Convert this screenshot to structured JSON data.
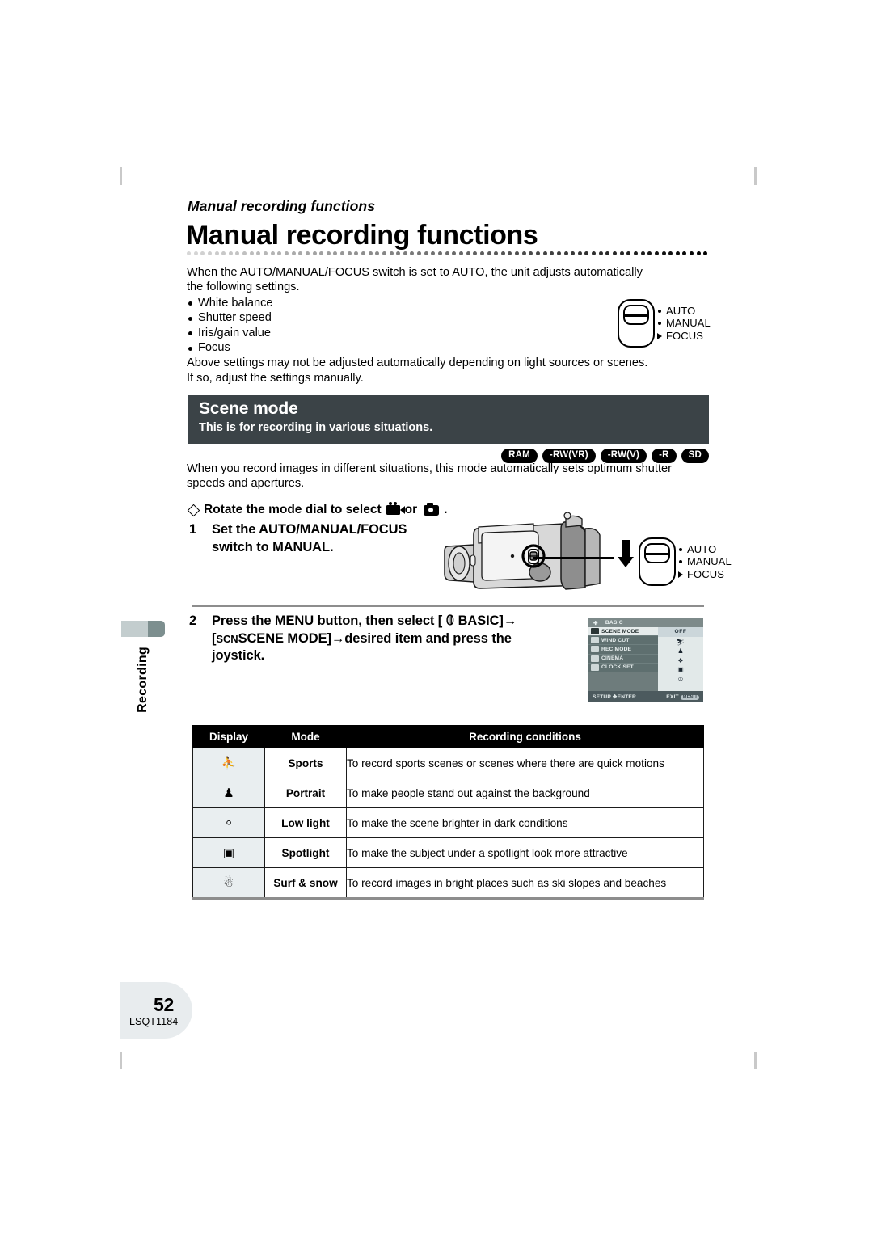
{
  "running_head": "Manual recording functions",
  "page_title": "Manual recording functions",
  "intro": {
    "paragraph1": "When the AUTO/MANUAL/FOCUS switch is set to AUTO, the unit adjusts automatically the following settings.",
    "bullets": [
      "White balance",
      "Shutter speed",
      "Iris/gain value",
      "Focus"
    ],
    "paragraph2": "Above settings may not be adjusted automatically depending on light sources or scenes. If so, adjust the settings manually."
  },
  "switch_labels": [
    "AUTO",
    "MANUAL",
    "FOCUS"
  ],
  "section": {
    "title": "Scene mode",
    "subtitle": "This is for recording in various situations.",
    "badges": [
      "RAM",
      "-RW(VR)",
      "-RW(V)",
      "-R",
      "SD"
    ],
    "body": "When you record images in different situations, this mode automatically sets optimum shutter speeds and apertures."
  },
  "steps": {
    "diamond": {
      "before": "Rotate the mode dial to select",
      "middle": "or",
      "after": "."
    },
    "step1": {
      "number": "1",
      "line1": "Set the AUTO/MANUAL/FOCUS",
      "line2": "switch to MANUAL."
    },
    "step2": {
      "number": "2",
      "line1_a": "Press the MENU button, then select [",
      "line1_b": "BASIC]",
      "line1_arrow": "→",
      "line2_a": "[",
      "line2_scn": "SCN",
      "line2_b": "SCENE MODE]",
      "line2_arrow": "→",
      "line2_c": "desired item and press the",
      "line3": "joystick."
    }
  },
  "lcd": {
    "title": "BASIC",
    "items": [
      {
        "label": "SCENE MODE",
        "selected": true
      },
      {
        "label": "WIND CUT",
        "selected": false
      },
      {
        "label": "REC MODE",
        "selected": false
      },
      {
        "label": "CINEMA",
        "selected": false
      },
      {
        "label": "CLOCK SET",
        "selected": false
      }
    ],
    "option_selected": "OFF",
    "option_icons": [
      "sports-icon",
      "portrait-icon",
      "low-light-icon",
      "spotlight-icon",
      "surf-snow-icon"
    ],
    "footer_left": "SETUP",
    "footer_enter": "ENTER",
    "footer_exit": "EXIT",
    "footer_exit_badge": "MENU"
  },
  "table": {
    "headers": [
      "Display",
      "Mode",
      "Recording conditions"
    ],
    "rows": [
      {
        "icon": "sports-icon",
        "glyph": "⛹",
        "mode": "Sports",
        "condition": "To record sports scenes or scenes where there are quick motions"
      },
      {
        "icon": "portrait-icon",
        "glyph": "♟",
        "mode": "Portrait",
        "condition": "To make people stand out against the background"
      },
      {
        "icon": "low-light-icon",
        "glyph": "⸰",
        "mode": "Low light",
        "condition": "To make the scene brighter in dark conditions"
      },
      {
        "icon": "spotlight-icon",
        "glyph": "▣",
        "mode": "Spotlight",
        "condition": "To make the subject under a spotlight look more attractive"
      },
      {
        "icon": "surf-snow-icon",
        "glyph": "☃",
        "mode": "Surf & snow",
        "condition": "To record images in bright places such as ski slopes and beaches"
      }
    ]
  },
  "side_tab_label": "Recording",
  "footer": {
    "page_number": "52",
    "doc_code": "LSQT1184"
  },
  "colors": {
    "section_header_bg": "#3b4347",
    "display_cell_bg": "#e9eef0",
    "side_tab_bg": "#c3cdce",
    "side_tab_cap": "#7d8f8f",
    "page_tab_bg": "#e8ecee"
  }
}
